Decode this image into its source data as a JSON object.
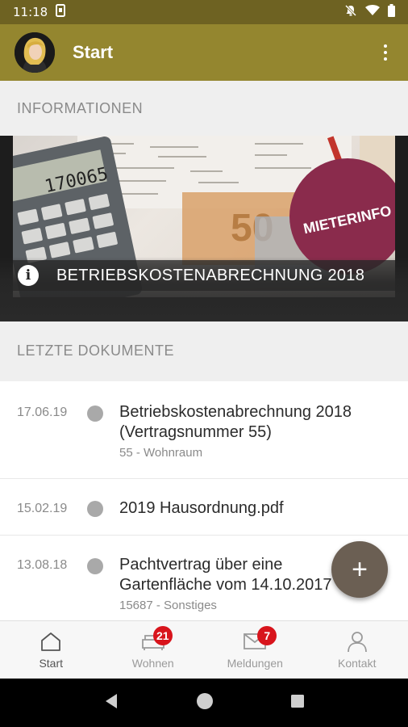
{
  "status_bar": {
    "time": "11:18",
    "icons": [
      "sim-icon",
      "mute-icon",
      "wifi-icon",
      "battery-icon"
    ]
  },
  "app_bar": {
    "title": "Start",
    "menu_icon": "more-vert-icon",
    "colors": {
      "app_bar": "#94862f",
      "status_bar": "#6e6222"
    }
  },
  "sections": {
    "informationen": "INFORMATIONEN",
    "letzte_dokumente": "LETZTE DOKUMENTE"
  },
  "banner": {
    "caption": "BETRIEBSKOSTENABRECHNUNG 2018",
    "stamp_text": "MIETERINFO",
    "calculator_display": "170065",
    "info_icon": "info-icon"
  },
  "documents": [
    {
      "date": "17.06.19",
      "title": "Betriebskostenabrechnung 2018\n(Vertragsnummer 55)",
      "subtitle": "55 - Wohnraum"
    },
    {
      "date": "15.02.19",
      "title": "2019 Hausordnung.pdf",
      "subtitle": ""
    },
    {
      "date": "13.08.18",
      "title": "Pachtvertrag über eine\nGartenfläche vom 14.10.2017",
      "subtitle": "15687 - Sonstiges"
    }
  ],
  "fab": {
    "label": "+",
    "icon": "add-icon"
  },
  "bottom_nav": [
    {
      "label": "Start",
      "icon": "home-icon",
      "badge": "",
      "active": true
    },
    {
      "label": "Wohnen",
      "icon": "sofa-icon",
      "badge": "21",
      "active": false
    },
    {
      "label": "Meldungen",
      "icon": "mail-icon",
      "badge": "7",
      "active": false
    },
    {
      "label": "Kontakt",
      "icon": "person-icon",
      "badge": "",
      "active": false
    }
  ],
  "system_nav": [
    "back-icon",
    "home-circle-icon",
    "recents-icon"
  ]
}
